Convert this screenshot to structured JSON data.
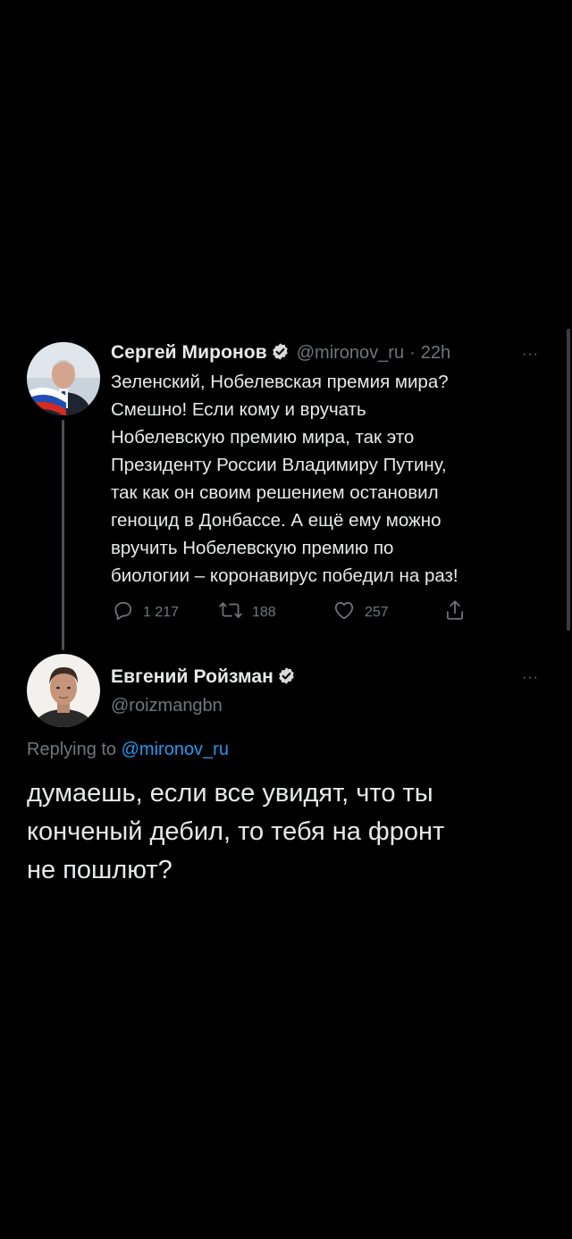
{
  "original_tweet": {
    "author_name": "Сергей Миронов",
    "handle": "@mironov_ru",
    "separator": "·",
    "time": "22h",
    "more": "···",
    "text": "Зеленский, Нобелевская премия мира?\nСмешно! Если кому и вручать\nНобелевскую премию мира, так это\nПрезиденту России Владимиру Путину,\nтак как он своим решением остановил\nгеноцид в Донбассе. А ещё ему можно\nвручить Нобелевскую премию по\nбиологии – коронавирус победил на раз!",
    "actions": {
      "replies": "1 217",
      "retweets": "188",
      "likes": "257"
    }
  },
  "reply_tweet": {
    "author_name": "Евгений Ройзман",
    "handle": "@roizmangbn",
    "more": "···",
    "replying_prefix": "Replying to",
    "replying_to": "@mironov_ru",
    "text": "думаешь, если все увидят, что ты\nконченый дебил, то тебя на фронт\nне пошлют?"
  },
  "colors": {
    "background": "#000000",
    "text": "#e7e9ea",
    "secondary": "#71767b",
    "link": "#1d9bf0",
    "verified": "#d9d9d9"
  },
  "icons": {
    "verified": "verified-badge-icon",
    "reply": "reply-icon",
    "retweet": "retweet-icon",
    "like": "heart-icon",
    "share": "share-icon",
    "more": "more-icon"
  }
}
